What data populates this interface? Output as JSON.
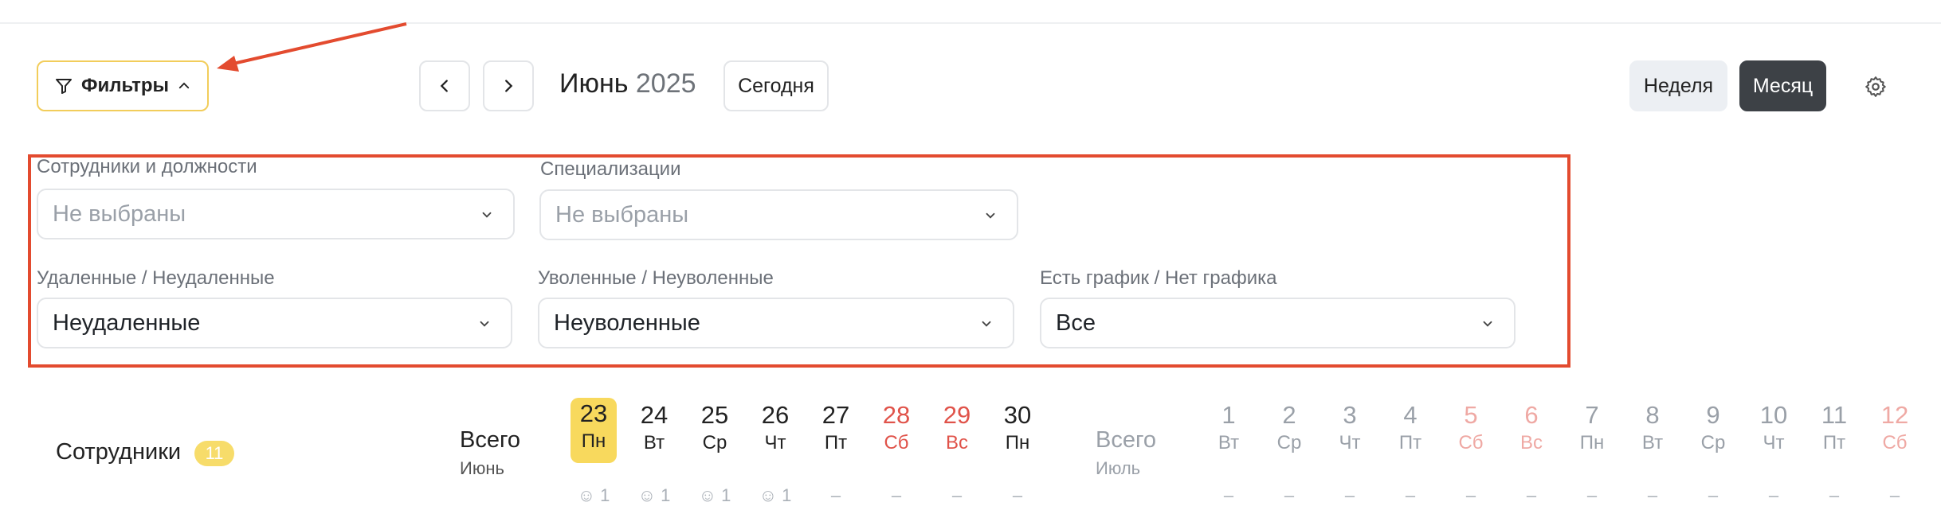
{
  "toolbar": {
    "filters_label": "Фильтры",
    "month": "Июнь",
    "year": "2025",
    "today_label": "Сегодня",
    "week_label": "Неделя",
    "month_label": "Месяц"
  },
  "filters": {
    "employees": {
      "label": "Сотрудники и должности",
      "value": "Не выбраны"
    },
    "specializations": {
      "label": "Специализации",
      "value": "Не выбраны"
    },
    "deleted": {
      "label": "Удаленные / Неудаленные",
      "value": "Неудаленные"
    },
    "dismissed": {
      "label": "Уволенные / Неуволенные",
      "value": "Неуволенные"
    },
    "schedule": {
      "label": "Есть график / Нет графика",
      "value": "Все"
    }
  },
  "calendar": {
    "employees_label": "Сотрудники",
    "employees_count": "11",
    "total_label": "Всего",
    "june_label": "Июнь",
    "july_label": "Июль",
    "june_days": [
      {
        "num": "23",
        "wd": "Пн",
        "weekend": false,
        "active": true
      },
      {
        "num": "24",
        "wd": "Вт",
        "weekend": false
      },
      {
        "num": "25",
        "wd": "Ср",
        "weekend": false
      },
      {
        "num": "26",
        "wd": "Чт",
        "weekend": false
      },
      {
        "num": "27",
        "wd": "Пт",
        "weekend": false
      },
      {
        "num": "28",
        "wd": "Сб",
        "weekend": true
      },
      {
        "num": "29",
        "wd": "Вс",
        "weekend": true
      },
      {
        "num": "30",
        "wd": "Пн",
        "weekend": false
      }
    ],
    "july_days": [
      {
        "num": "1",
        "wd": "Вт",
        "weekend": false
      },
      {
        "num": "2",
        "wd": "Ср",
        "weekend": false
      },
      {
        "num": "3",
        "wd": "Чт",
        "weekend": false
      },
      {
        "num": "4",
        "wd": "Пт",
        "weekend": false
      },
      {
        "num": "5",
        "wd": "Сб",
        "weekend": true
      },
      {
        "num": "6",
        "wd": "Вс",
        "weekend": true
      },
      {
        "num": "7",
        "wd": "Пн",
        "weekend": false
      },
      {
        "num": "8",
        "wd": "Вт",
        "weekend": false
      },
      {
        "num": "9",
        "wd": "Ср",
        "weekend": false
      },
      {
        "num": "10",
        "wd": "Чт",
        "weekend": false
      },
      {
        "num": "11",
        "wd": "Пт",
        "weekend": false
      },
      {
        "num": "12",
        "wd": "Сб",
        "weekend": true
      }
    ],
    "june_counts": [
      "1",
      "1",
      "1",
      "1",
      "–",
      "–",
      "–",
      "–"
    ],
    "july_counts": [
      "–",
      "–",
      "–",
      "–",
      "–",
      "–",
      "–",
      "–",
      "–",
      "–",
      "–",
      "–"
    ]
  },
  "colors": {
    "accent_yellow": "#f8d95d",
    "annotation_red": "#e34b2f",
    "weekend_red": "#e0534a",
    "weekend_red_muted": "#efa9a4",
    "dark_button": "#3d4146"
  }
}
